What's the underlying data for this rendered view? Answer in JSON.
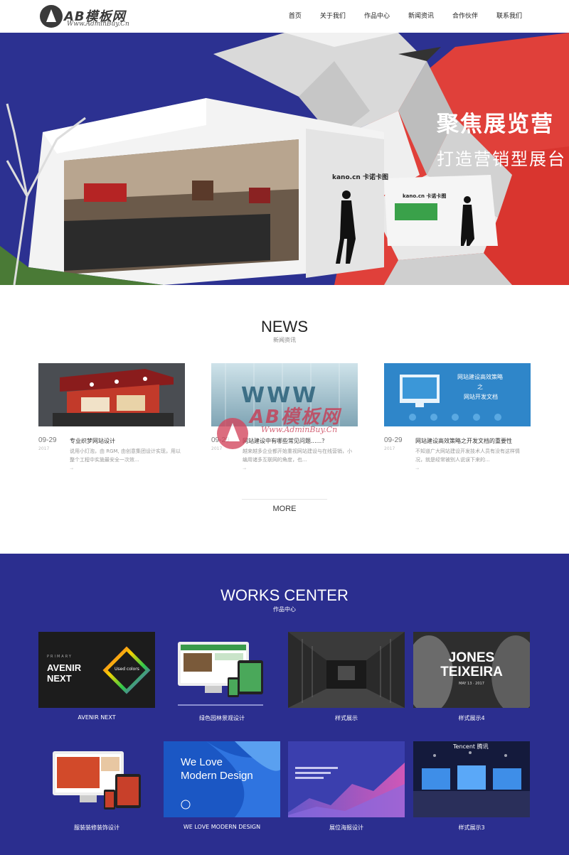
{
  "header": {
    "logo_text": "AB模板网",
    "logo_sub": "Www.AdminBuy.Cn",
    "nav": [
      "首页",
      "关于我们",
      "作品中心",
      "新闻资讯",
      "合作伙伴",
      "联系我们"
    ]
  },
  "hero": {
    "title": "聚焦展览营",
    "subtitle": "打造营销型展台",
    "brand_left": "kano.cn 卡诺卡图",
    "brand_right": "kano.cn 卡诺卡图"
  },
  "news": {
    "title": "NEWS",
    "subtitle": "新闻资讯",
    "items": [
      {
        "date": "09-29",
        "date_dim": "2017",
        "title": "专业织梦网站设计",
        "desc": "说用小灯泡，由 RGM, 由创意集团设计实现，用以整个工程中实施最安全一次效..."
      },
      {
        "date": "09-29",
        "date_dim": "2017",
        "title": "网站建设中有哪些常见问题......？",
        "desc": "越来越多企业都开始重视网站建设与在线营销，小编用诸多互联网的角度，也..."
      },
      {
        "date": "09-29",
        "date_dim": "2017",
        "title": "网站建设高效策略之开发文档的重要性",
        "desc": "不知道广大网站建设开发技术人员有没有这样情况，就是经常被别人说误下来的..."
      }
    ],
    "more": "MORE",
    "arrow": "→",
    "thumb2_text": "WWW",
    "thumb3_line1": "网站建设高效策略",
    "thumb3_line2": "之",
    "thumb3_line3": "网站开发文档"
  },
  "watermark": {
    "main": "AB模板网",
    "sub": "Www.AdminBuy.Cn"
  },
  "works": {
    "title": "WORKS CENTER",
    "subtitle": "作品中心",
    "items": [
      {
        "caption": "AVENIR NEXT"
      },
      {
        "caption": "绿色园林景观设计"
      },
      {
        "caption": "样式展示"
      },
      {
        "caption": "样式展示4"
      },
      {
        "caption": "服装装修装饰设计"
      },
      {
        "caption": "WE LOVE MODERN DESIGN"
      },
      {
        "caption": "展位海报设计"
      },
      {
        "caption": "样式展示3"
      }
    ],
    "avenir_primary": "PRIMARY",
    "avenir_text": "AVENIR\nNEXT",
    "avenir_badge": "Used colors",
    "jones_top": "JONES",
    "jones_bottom": "TEIXEIRA",
    "jones_date": "MAY 13 · 2017",
    "welove_text": "We Love\nModern Design",
    "tencent": "Tencent 腾讯"
  }
}
